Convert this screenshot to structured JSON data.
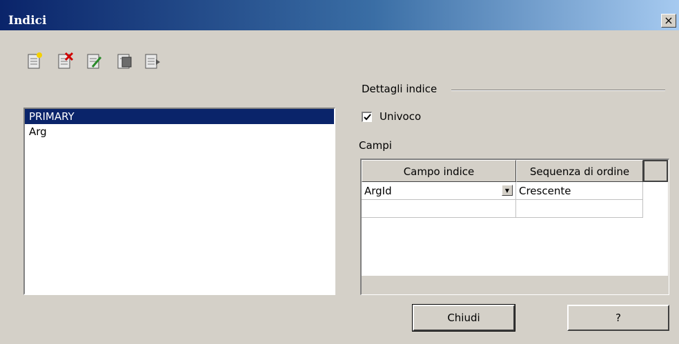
{
  "window": {
    "title": "Indici",
    "close_glyph": "×"
  },
  "toolbar": {
    "buttons": [
      {
        "icon": "new-index-icon"
      },
      {
        "icon": "delete-index-icon"
      },
      {
        "icon": "rename-index-icon"
      },
      {
        "icon": "save-index-icon"
      },
      {
        "icon": "reset-index-icon"
      }
    ]
  },
  "index_list": {
    "items": [
      "PRIMARY",
      "Arg"
    ],
    "selected": "PRIMARY"
  },
  "details": {
    "group_title": "Dettagli indice",
    "unique_label": "Univoco",
    "unique_checked": true,
    "fields_label": "Campi"
  },
  "grid": {
    "headers": [
      "Campo indice",
      "Sequenza di ordine"
    ],
    "rows": [
      {
        "field": "ArgId",
        "order": "Crescente"
      },
      {
        "field": "",
        "order": ""
      }
    ]
  },
  "buttons": {
    "close": "Chiudi",
    "help": "?"
  },
  "colors": {
    "title_start": "#0a246a",
    "title_end": "#a6caf0",
    "selection": "#0a246a",
    "face": "#d4d0c8"
  }
}
